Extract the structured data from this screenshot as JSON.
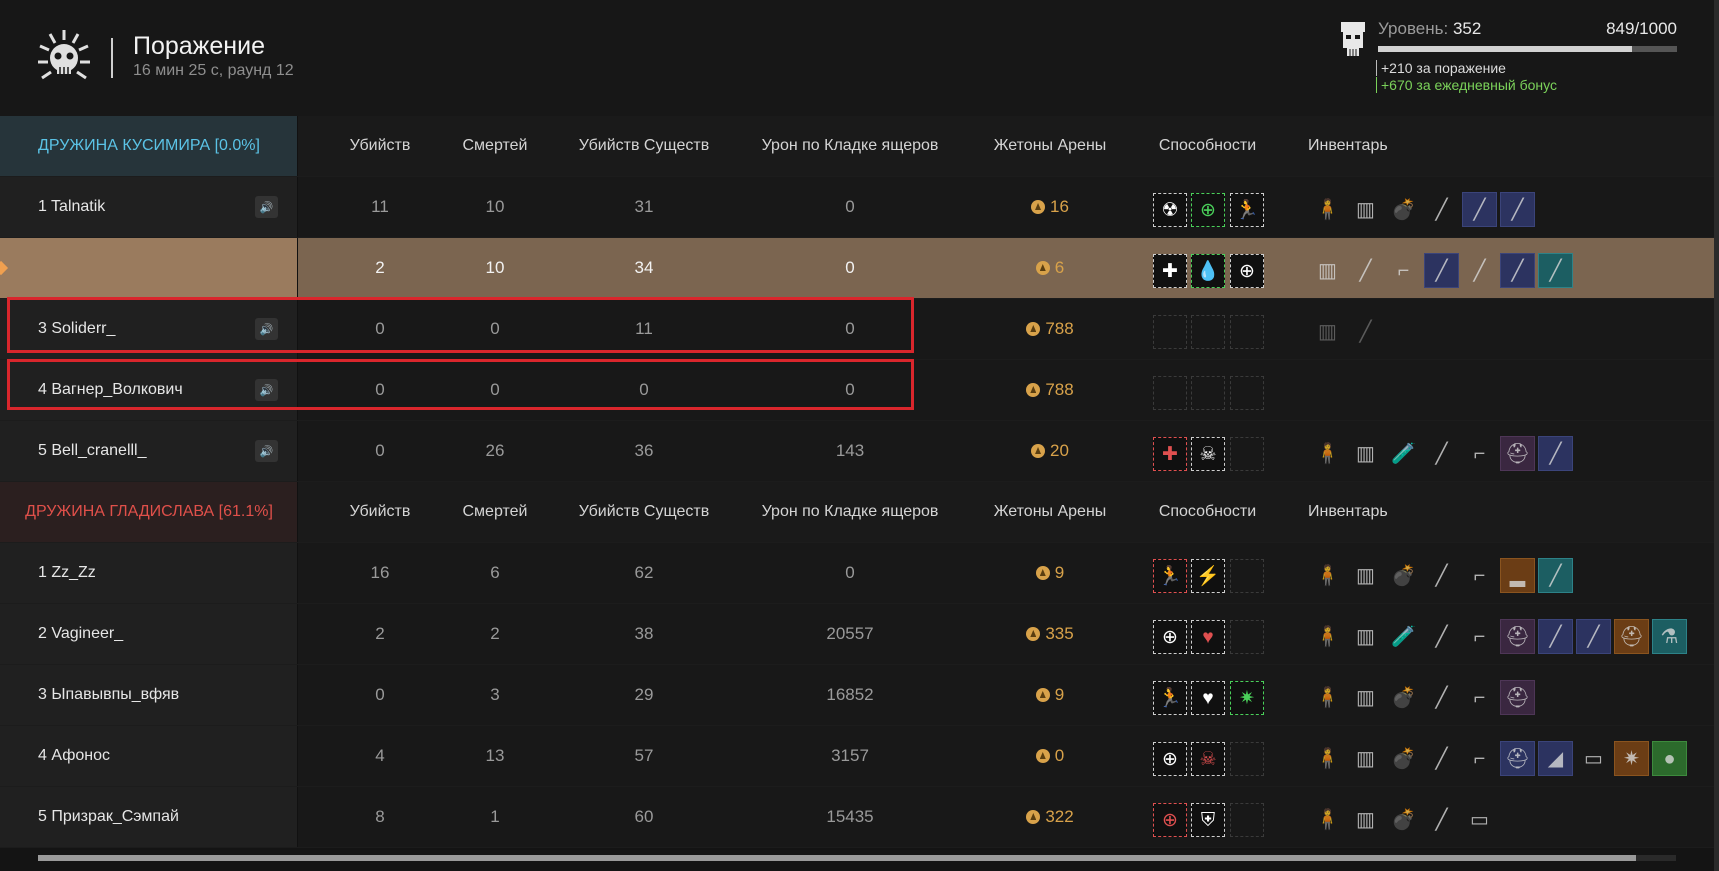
{
  "header": {
    "title": "Поражение",
    "subtitle": "16 мин 25 с, раунд 12"
  },
  "level": {
    "label": "Уровень:",
    "value": "352",
    "xp": "849/1000",
    "progress_fraction": 0.849,
    "bonus_defeat": "+210 за поражение",
    "bonus_daily": "+670 за ежедневный бонус"
  },
  "columns": {
    "kills": "Убийств",
    "deaths": "Смертей",
    "beast_kills": "Убийств Существ",
    "lizard_damage": "Урон по Кладке ящеров",
    "arena_tokens": "Жетоны Арены",
    "abilities": "Способности",
    "inventory": "Инвентарь"
  },
  "teams": [
    {
      "name": "ДРУЖИНА КУСИМИРА [0.0%]",
      "color": "#5bc3e6",
      "players": [
        {
          "name": "1 Talnatik",
          "kills": "11",
          "deaths": "10",
          "beasts": "31",
          "damage": "0",
          "tokens": "16",
          "abilities": [
            {
              "icon": "radiation-icon",
              "glyph": "☢",
              "color": "#ffffff",
              "border": ""
            },
            {
              "icon": "crosshair-icon",
              "glyph": "⊕",
              "color": "#4ad05a",
              "border": "green"
            },
            {
              "icon": "run-icon",
              "glyph": "🏃",
              "color": "#ffffff",
              "border": ""
            }
          ],
          "inventory": [
            {
              "icon": "armor-icon",
              "glyph": "🧍",
              "box": ""
            },
            {
              "icon": "vest-icon",
              "glyph": "▥",
              "box": ""
            },
            {
              "icon": "grenade-icon",
              "glyph": "💣",
              "box": ""
            },
            {
              "icon": "rifle-icon",
              "glyph": "╱",
              "box": ""
            },
            {
              "icon": "blade-icon",
              "glyph": "╱",
              "box": "blue"
            },
            {
              "icon": "blade-icon",
              "glyph": "╱",
              "box": "blue"
            }
          ]
        },
        {
          "name": "",
          "kills": "2",
          "deaths": "10",
          "beasts": "34",
          "damage": "0",
          "tokens": "6",
          "me": true,
          "abilities": [
            {
              "icon": "medic-icon",
              "glyph": "✚",
              "color": "#ffffff",
              "border": ""
            },
            {
              "icon": "heal-drop-icon",
              "glyph": "💧",
              "color": "#4ad05a",
              "border": "green"
            },
            {
              "icon": "crosshair-icon",
              "glyph": "⊕",
              "color": "#ffffff",
              "border": ""
            }
          ],
          "inventory": [
            {
              "icon": "vest-icon",
              "glyph": "▥",
              "box": ""
            },
            {
              "icon": "rifle-icon",
              "glyph": "╱",
              "box": ""
            },
            {
              "icon": "pistol-icon",
              "glyph": "⌐",
              "box": ""
            },
            {
              "icon": "rifle-icon",
              "glyph": "╱",
              "box": "blue"
            },
            {
              "icon": "rifle-icon",
              "glyph": "╱",
              "box": ""
            },
            {
              "icon": "blade-icon",
              "glyph": "╱",
              "box": "blue"
            },
            {
              "icon": "spear-icon",
              "glyph": "╱",
              "box": "teal"
            }
          ]
        },
        {
          "name": "3 Soliderr_",
          "kills": "0",
          "deaths": "0",
          "beasts": "11",
          "damage": "0",
          "tokens": "788",
          "abilities": [],
          "inventory": [
            {
              "icon": "vest-icon",
              "glyph": "▥",
              "box": "",
              "dim": true
            },
            {
              "icon": "rifle-icon",
              "glyph": "╱",
              "box": "",
              "dim": true
            }
          ]
        },
        {
          "name": "4 Вагнер_Волкович",
          "kills": "0",
          "deaths": "0",
          "beasts": "0",
          "damage": "0",
          "tokens": "788",
          "abilities": [],
          "inventory": []
        },
        {
          "name": "5 Bell_cranelll_",
          "kills": "0",
          "deaths": "26",
          "beasts": "36",
          "damage": "143",
          "tokens": "20",
          "abilities": [
            {
              "icon": "medic-icon",
              "glyph": "✚",
              "color": "#e05050",
              "border": "red"
            },
            {
              "icon": "skull-wings-icon",
              "glyph": "☠",
              "color": "#ffffff",
              "border": ""
            }
          ],
          "inventory": [
            {
              "icon": "armor-icon",
              "glyph": "🧍",
              "box": ""
            },
            {
              "icon": "vest-icon",
              "glyph": "▥",
              "box": ""
            },
            {
              "icon": "flask-icon",
              "glyph": "🧪",
              "box": ""
            },
            {
              "icon": "rifle-icon",
              "glyph": "╱",
              "box": ""
            },
            {
              "icon": "pistol-icon",
              "glyph": "⌐",
              "box": ""
            },
            {
              "icon": "helmet-icon",
              "glyph": "⛑",
              "box": "purple"
            },
            {
              "icon": "blade-icon",
              "glyph": "╱",
              "box": "blue"
            }
          ]
        }
      ]
    },
    {
      "name": "ДРУЖИНА ГЛАДИСЛАВА [61.1%]",
      "color": "#e0504a",
      "players": [
        {
          "name": "1 Zz_Zz",
          "kills": "16",
          "deaths": "6",
          "beasts": "62",
          "damage": "0",
          "tokens": "9",
          "abilities": [
            {
              "icon": "run-icon",
              "glyph": "🏃",
              "color": "#e05050",
              "border": "red"
            },
            {
              "icon": "strike-icon",
              "glyph": "⚡",
              "color": "#ffffff",
              "border": ""
            }
          ],
          "inventory": [
            {
              "icon": "armor-icon",
              "glyph": "🧍",
              "box": ""
            },
            {
              "icon": "vest-icon",
              "glyph": "▥",
              "box": ""
            },
            {
              "icon": "grenade-icon",
              "glyph": "💣",
              "box": ""
            },
            {
              "icon": "rifle-icon",
              "glyph": "╱",
              "box": ""
            },
            {
              "icon": "pistol-icon",
              "glyph": "⌐",
              "box": ""
            },
            {
              "icon": "boots-icon",
              "glyph": "▂",
              "box": "orange"
            },
            {
              "icon": "spear-icon",
              "glyph": "╱",
              "box": "teal"
            }
          ]
        },
        {
          "name": "2 Vagineer_",
          "kills": "2",
          "deaths": "2",
          "beasts": "38",
          "damage": "20557",
          "tokens": "335",
          "abilities": [
            {
              "icon": "crosshair-icon",
              "glyph": "⊕",
              "color": "#ffffff",
              "border": ""
            },
            {
              "icon": "heart-plus-icon",
              "glyph": "♥",
              "color": "#e05050",
              "border": ""
            }
          ],
          "inventory": [
            {
              "icon": "armor-icon",
              "glyph": "🧍",
              "box": ""
            },
            {
              "icon": "vest-icon",
              "glyph": "▥",
              "box": ""
            },
            {
              "icon": "flask-icon",
              "glyph": "🧪",
              "box": ""
            },
            {
              "icon": "rifle-icon",
              "glyph": "╱",
              "box": ""
            },
            {
              "icon": "pistol-icon",
              "glyph": "⌐",
              "box": ""
            },
            {
              "icon": "helmet-icon",
              "glyph": "⛑",
              "box": "purple"
            },
            {
              "icon": "blade-icon",
              "glyph": "╱",
              "box": "blue"
            },
            {
              "icon": "blade-icon",
              "glyph": "╱",
              "box": "blue"
            },
            {
              "icon": "helmet-icon",
              "glyph": "⛑",
              "box": "orange"
            },
            {
              "icon": "potion-icon",
              "glyph": "⚗",
              "box": "teal"
            }
          ]
        },
        {
          "name": "3 Ыпавывпы_вфяв",
          "kills": "0",
          "deaths": "3",
          "beasts": "29",
          "damage": "16852",
          "tokens": "9",
          "abilities": [
            {
              "icon": "run-icon",
              "glyph": "🏃",
              "color": "#ffffff",
              "border": ""
            },
            {
              "icon": "heart-plus-icon",
              "glyph": "♥",
              "color": "#ffffff",
              "border": ""
            },
            {
              "icon": "claw-icon",
              "glyph": "✷",
              "color": "#4ad05a",
              "border": "green"
            }
          ],
          "inventory": [
            {
              "icon": "armor-icon",
              "glyph": "🧍",
              "box": ""
            },
            {
              "icon": "vest-icon",
              "glyph": "▥",
              "box": ""
            },
            {
              "icon": "grenade-icon",
              "glyph": "💣",
              "box": ""
            },
            {
              "icon": "rifle-icon",
              "glyph": "╱",
              "box": ""
            },
            {
              "icon": "pistol-icon",
              "glyph": "⌐",
              "box": ""
            },
            {
              "icon": "helmet-icon",
              "glyph": "⛑",
              "box": "purple"
            }
          ]
        },
        {
          "name": "4 Афонос",
          "kills": "4",
          "deaths": "13",
          "beasts": "57",
          "damage": "3157",
          "tokens": "0",
          "abilities": [
            {
              "icon": "crosshair-icon",
              "glyph": "⊕",
              "color": "#ffffff",
              "border": ""
            },
            {
              "icon": "skull-icon",
              "glyph": "☠",
              "color": "#e05050",
              "border": ""
            }
          ],
          "inventory": [
            {
              "icon": "armor-icon",
              "glyph": "🧍",
              "box": ""
            },
            {
              "icon": "vest-icon",
              "glyph": "▥",
              "box": ""
            },
            {
              "icon": "grenade-icon",
              "glyph": "💣",
              "box": ""
            },
            {
              "icon": "rifle-icon",
              "glyph": "╱",
              "box": ""
            },
            {
              "icon": "pistol-icon",
              "glyph": "⌐",
              "box": ""
            },
            {
              "icon": "helmet-icon",
              "glyph": "⛑",
              "box": "blue"
            },
            {
              "icon": "cloak-icon",
              "glyph": "◢",
              "box": "blue"
            },
            {
              "icon": "device-icon",
              "glyph": "▭",
              "box": ""
            },
            {
              "icon": "claw-icon",
              "glyph": "✷",
              "box": "orange"
            },
            {
              "icon": "orb-icon",
              "glyph": "●",
              "box": "green"
            }
          ]
        },
        {
          "name": "5 Призрак_Сэмпай",
          "kills": "8",
          "deaths": "1",
          "beasts": "60",
          "damage": "15435",
          "tokens": "322",
          "abilities": [
            {
              "icon": "crosshair-icon",
              "glyph": "⊕",
              "color": "#e05050",
              "border": "red"
            },
            {
              "icon": "shield-plus-icon",
              "glyph": "⛨",
              "color": "#ffffff",
              "border": ""
            }
          ],
          "inventory": [
            {
              "icon": "armor-icon",
              "glyph": "🧍",
              "box": ""
            },
            {
              "icon": "vest-icon",
              "glyph": "▥",
              "box": ""
            },
            {
              "icon": "grenade-icon",
              "glyph": "💣",
              "box": ""
            },
            {
              "icon": "rifle-icon",
              "glyph": "╱",
              "box": ""
            },
            {
              "icon": "device-icon",
              "glyph": "▭",
              "box": ""
            }
          ]
        }
      ]
    }
  ]
}
